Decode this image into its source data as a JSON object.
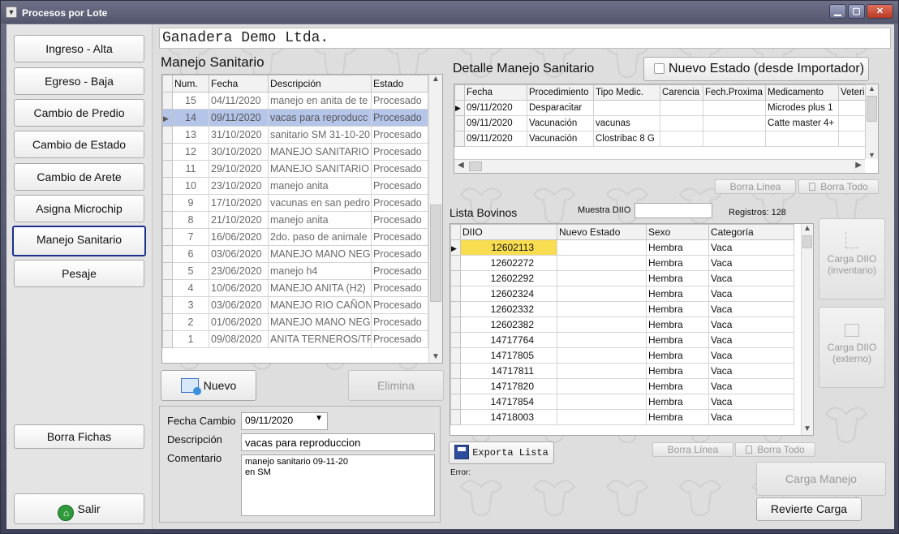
{
  "window": {
    "title": "Procesos por Lote",
    "minimize": "▁",
    "maximize": "▢",
    "close": "✕"
  },
  "nav": {
    "items": [
      "Ingreso - Alta",
      "Egreso - Baja",
      "Cambio de Predio",
      "Cambio de Estado",
      "Cambio de Arete",
      "Asigna Microchip",
      "Manejo Sanitario",
      "Pesaje"
    ],
    "borra_fichas": "Borra Fichas",
    "salir": "Salir"
  },
  "company": "Ganadera Demo Ltda.",
  "manejo": {
    "title": "Manejo Sanitario",
    "columns": [
      "Num.",
      "Fecha",
      "Descripción",
      "Estado"
    ],
    "rows": [
      [
        "15",
        "04/11/2020",
        "manejo en anita de te",
        "Procesado"
      ],
      [
        "14",
        "09/11/2020",
        "vacas para reproducc",
        "Procesado"
      ],
      [
        "13",
        "31/10/2020",
        "sanitario SM 31-10-20",
        "Procesado"
      ],
      [
        "12",
        "30/10/2020",
        "MANEJO SANITARIO (",
        "Procesado"
      ],
      [
        "11",
        "29/10/2020",
        "MANEJO SANITARIO S",
        "Procesado"
      ],
      [
        "10",
        "23/10/2020",
        "manejo anita",
        "Procesado"
      ],
      [
        "9",
        "17/10/2020",
        "vacunas en san pedro",
        "Procesado"
      ],
      [
        "8",
        "21/10/2020",
        "manejo anita",
        "Procesado"
      ],
      [
        "7",
        "16/06/2020",
        "2do. paso de animale",
        "Procesado"
      ],
      [
        "6",
        "03/06/2020",
        "MANEJO MANO NEGRA",
        "Procesado"
      ],
      [
        "5",
        "23/06/2020",
        "manejo h4",
        "Procesado"
      ],
      [
        "4",
        "10/06/2020",
        "MANEJO ANITA (H2)",
        "Procesado"
      ],
      [
        "3",
        "03/06/2020",
        "MANEJO RIO CAÑON (",
        "Procesado"
      ],
      [
        "2",
        "01/06/2020",
        "MANEJO MANO NEGRA",
        "Procesado"
      ],
      [
        "1",
        "09/08/2020",
        "ANITA TERNEROS/TR",
        "Procesado"
      ]
    ],
    "nuevo": "Nuevo",
    "elimina": "Elimina"
  },
  "form": {
    "fecha_label": "Fecha Cambio",
    "fecha_value": "09/11/2020",
    "descripcion_label": "Descripción",
    "descripcion_value": "vacas para reproduccion",
    "comentario_label": "Comentario",
    "comentario_line1": "manejo sanitario 09-11-20",
    "comentario_line2": "en SM"
  },
  "detalle": {
    "title": "Detalle Manejo Sanitario",
    "nuevo_estado": "Nuevo Estado (desde Importador)",
    "columns": [
      "Fecha",
      "Procedimiento",
      "Tipo Medic.",
      "Carencia",
      "Fech.Proxima",
      "Medicamento",
      "Veteri"
    ],
    "rows": [
      [
        "09/11/2020",
        "Desparacitar",
        "",
        "",
        "",
        "Microdes plus 1",
        ""
      ],
      [
        "09/11/2020",
        "Vacunación",
        "vacunas",
        "",
        "",
        "Catte master 4+",
        ""
      ],
      [
        "09/11/2020",
        "Vacunación",
        "Clostribac 8 G",
        "",
        "",
        "",
        ""
      ]
    ],
    "borra_linea": "Borra Línea",
    "borra_todo": "Borra Todo"
  },
  "bovinos": {
    "title": "Lista Bovinos",
    "muestra_label": "Muestra DIIO",
    "muestra_value": "",
    "registros_label": "Registros: 128",
    "columns": [
      "DIIO",
      "Nuevo Estado",
      "Sexo",
      "Categoría"
    ],
    "rows": [
      [
        "12602113",
        "",
        "Hembra",
        "Vaca"
      ],
      [
        "12602272",
        "",
        "Hembra",
        "Vaca"
      ],
      [
        "12602292",
        "",
        "Hembra",
        "Vaca"
      ],
      [
        "12602324",
        "",
        "Hembra",
        "Vaca"
      ],
      [
        "12602332",
        "",
        "Hembra",
        "Vaca"
      ],
      [
        "12602382",
        "",
        "Hembra",
        "Vaca"
      ],
      [
        "14717764",
        "",
        "Hembra",
        "Vaca"
      ],
      [
        "14717805",
        "",
        "Hembra",
        "Vaca"
      ],
      [
        "14717811",
        "",
        "Hembra",
        "Vaca"
      ],
      [
        "14717820",
        "",
        "Hembra",
        "Vaca"
      ],
      [
        "14717854",
        "",
        "Hembra",
        "Vaca"
      ],
      [
        "14718003",
        "",
        "Hembra",
        "Vaca"
      ]
    ],
    "exporta": "Exporta Lista",
    "borra_linea": "Borra Línea",
    "borra_todo": "Borra Todo",
    "error_label": "Error:"
  },
  "side": {
    "carga_inv_line1": "Carga DIIO",
    "carga_inv_line2": "(inventario)",
    "carga_ext_line1": "Carga DIIO",
    "carga_ext_line2": "(externo)",
    "carga_manejo": "Carga Manejo",
    "revierte": "Revierte Carga"
  }
}
